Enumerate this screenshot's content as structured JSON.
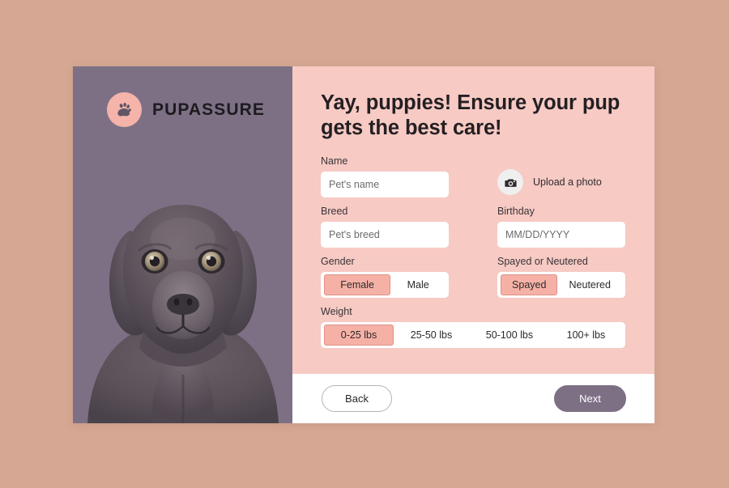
{
  "brand": {
    "name": "PUPASSURE",
    "logo_icon": "paw-print-icon",
    "badge_color": "#f5b3aa"
  },
  "sidebar": {
    "background_color": "#7d7085",
    "artwork": "black-labrador-puppy-photo"
  },
  "panel": {
    "background_color": "#f7cac4",
    "headline": "Yay, puppies! Ensure your pup gets the best care!"
  },
  "form": {
    "name": {
      "label": "Name",
      "placeholder": "Pet's name",
      "value": ""
    },
    "upload": {
      "label": "Upload a photo",
      "icon": "camera-icon"
    },
    "breed": {
      "label": "Breed",
      "placeholder": "Pet's breed",
      "value": ""
    },
    "birthday": {
      "label": "Birthday",
      "placeholder": "MM/DD/YYYY",
      "value": ""
    },
    "gender": {
      "label": "Gender",
      "options": [
        "Female",
        "Male"
      ],
      "selected": "Female"
    },
    "fixed": {
      "label": "Spayed or Neutered",
      "options": [
        "Spayed",
        "Neutered"
      ],
      "selected": "Spayed"
    },
    "weight": {
      "label": "Weight",
      "options": [
        "0-25 lbs",
        "25-50 lbs",
        "50-100 lbs",
        "100+ lbs"
      ],
      "selected": "0-25 lbs"
    }
  },
  "footer": {
    "back_label": "Back",
    "next_label": "Next",
    "next_color": "#7d7085"
  },
  "page": {
    "background_color": "#d6a893"
  }
}
